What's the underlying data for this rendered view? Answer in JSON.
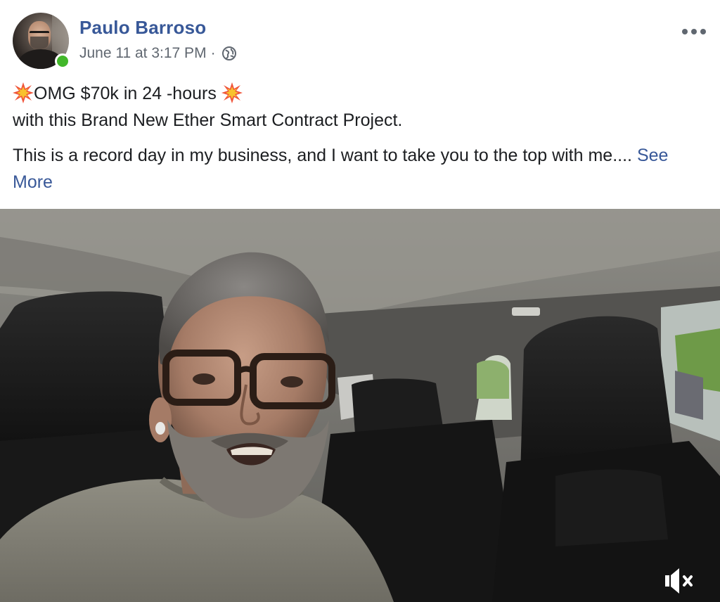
{
  "author": {
    "name": "Paulo Barroso",
    "online": true,
    "avatar_icon": "profile-photo",
    "online_color": "#42b72a"
  },
  "post": {
    "timestamp": "June 11 at 3:17 PM",
    "separator": "·",
    "audience_icon": "globe-icon",
    "more_icon": "more-options-icon",
    "text": {
      "headline": "OMG $70k in 24 -hours",
      "headline_icon": "collision-burst-icon",
      "line_2": "with this Brand New Ether Smart Contract Project.",
      "paragraph_2": "This is a record day in my business, and I want to take you to the top with me....",
      "see_more": "See More"
    }
  },
  "video": {
    "description_icon": "video-player",
    "mute_icon": "speaker-muted-icon"
  },
  "colors": {
    "link": "#385898",
    "text": "#1c1e21",
    "meta": "#606770",
    "burst": "#f0543a"
  }
}
